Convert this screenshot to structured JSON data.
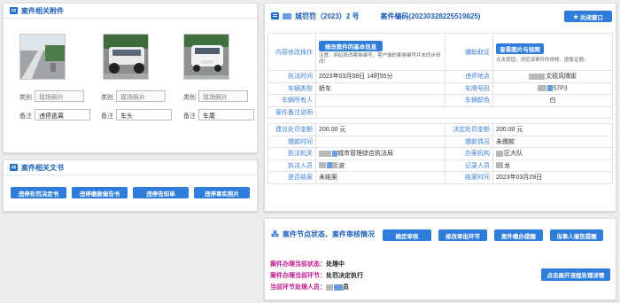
{
  "attachments": {
    "title": "案件相关附件",
    "photos": [
      {
        "category_label": "类别",
        "category_value": "现场照片",
        "note_label": "备注",
        "note_value": "违停逃离"
      },
      {
        "category_label": "类别",
        "category_value": "现场照片",
        "note_label": "备注",
        "note_value": "车头"
      },
      {
        "category_label": "类别",
        "category_value": "现场照片",
        "note_label": "备注",
        "note_value": "车尾"
      }
    ]
  },
  "documents": {
    "title": "案件相关文书",
    "buttons": [
      "违停处罚决定书",
      "违停缴款催告书",
      "违停告知单",
      "违停事实照片"
    ]
  },
  "case": {
    "doc_number": "城罚罚（2023）2 号",
    "case_code": "案件编码(20230328225519825)",
    "close_button": "关闭窗口",
    "rows": {
      "modify_label": "内容修改操作",
      "modify_button": "修改案件的基本信息",
      "modify_note": "注意：网站修改案卷编号，客户端的案卷编号并未同步修改！",
      "evidence_label": "辅助取证",
      "evidence_button": "查看图片与视频",
      "evidence_note": "点击按钮，浏览该案件的视频、图像证据。",
      "exec_time_label": "执法时间",
      "exec_time_value": "2023年03月08日 14时55分",
      "location_label": "违停地点",
      "location_value": "文德风隅街",
      "vehicle_type_label": "车辆类型",
      "vehicle_type_value": "轿车",
      "plate_label": "车牌号码",
      "plate_value": "57P3",
      "owner_label": "车辆所有人",
      "owner_value": "",
      "color_label": "车辆颜色",
      "color_value": "白",
      "remark_label": "案件备注说明",
      "remark_value": "",
      "penalty_label": "建议处罚金额",
      "penalty_value": "200.00 元",
      "decision_label": "决定处罚金额",
      "decision_value": "200.00 元",
      "paytime_label": "缴款时间",
      "paytime_value": "",
      "paystatus_label": "缴款情况",
      "paystatus_value": "未缴款",
      "agency_label": "执法机关",
      "agency_value": "城市管理综合执法局",
      "office_label": "办案机构",
      "office_value": "区大队",
      "officer_label": "执法人员",
      "officer_value": "波",
      "recorder_label": "记录人员",
      "recorder_value": "龙",
      "closed_label": "是否结案",
      "closed_value": "未结案",
      "closetime_label": "结案时间",
      "closetime_value": "2023年03月29日"
    }
  },
  "status": {
    "title": "案件节点状态、案件审核情况",
    "buttons": [
      "确定审核",
      "修改审批环节",
      "案件缴办提醒",
      "当事人催告提醒"
    ],
    "state_label": "案件办理当前状态：",
    "state_value": "处理中",
    "node_label": "案件办理当前环节：",
    "node_value": "处罚决定执行",
    "handler_label": "当前环节处理人员：",
    "handler_value": "员",
    "flow_button": "点击展开流程处理详情"
  }
}
